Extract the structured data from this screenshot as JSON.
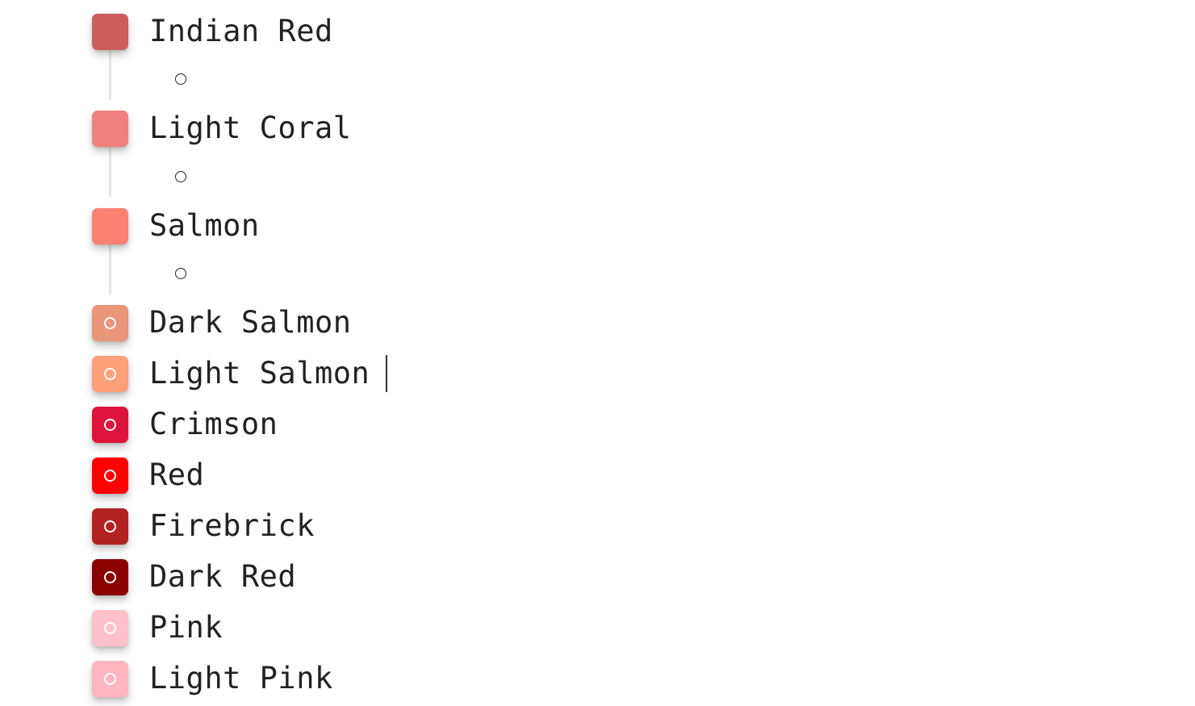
{
  "items": [
    {
      "label": "Indian Red",
      "color": "#CD5C5C",
      "has_children": true,
      "icon": "rounded-square"
    },
    {
      "label": "Light Coral",
      "color": "#F08080",
      "has_children": true,
      "icon": "rounded-square"
    },
    {
      "label": "Salmon",
      "color": "#FA8072",
      "has_children": true,
      "icon": "rounded-square"
    },
    {
      "label": "Dark Salmon",
      "color": "#E9967A",
      "has_children": false,
      "icon": "circle-icon"
    },
    {
      "label": "Light Salmon",
      "color": "#FFA07A",
      "has_children": false,
      "icon": "circle-icon",
      "editing": true
    },
    {
      "label": "Crimson",
      "color": "#DC143C",
      "has_children": false,
      "icon": "circle-icon"
    },
    {
      "label": "Red",
      "color": "#FF0000",
      "has_children": false,
      "icon": "circle-icon"
    },
    {
      "label": "Firebrick",
      "color": "#B22222",
      "has_children": false,
      "icon": "circle-icon"
    },
    {
      "label": "Dark Red",
      "color": "#8B0000",
      "has_children": false,
      "icon": "circle-icon"
    },
    {
      "label": "Pink",
      "color": "#FFC0CB",
      "has_children": false,
      "icon": "circle-icon"
    },
    {
      "label": "Light Pink",
      "color": "#FFB6C1",
      "has_children": false,
      "icon": "circle-icon"
    }
  ],
  "colors": {
    "text": "#222222",
    "connector": "#e6e6e6",
    "background": "#ffffff"
  }
}
